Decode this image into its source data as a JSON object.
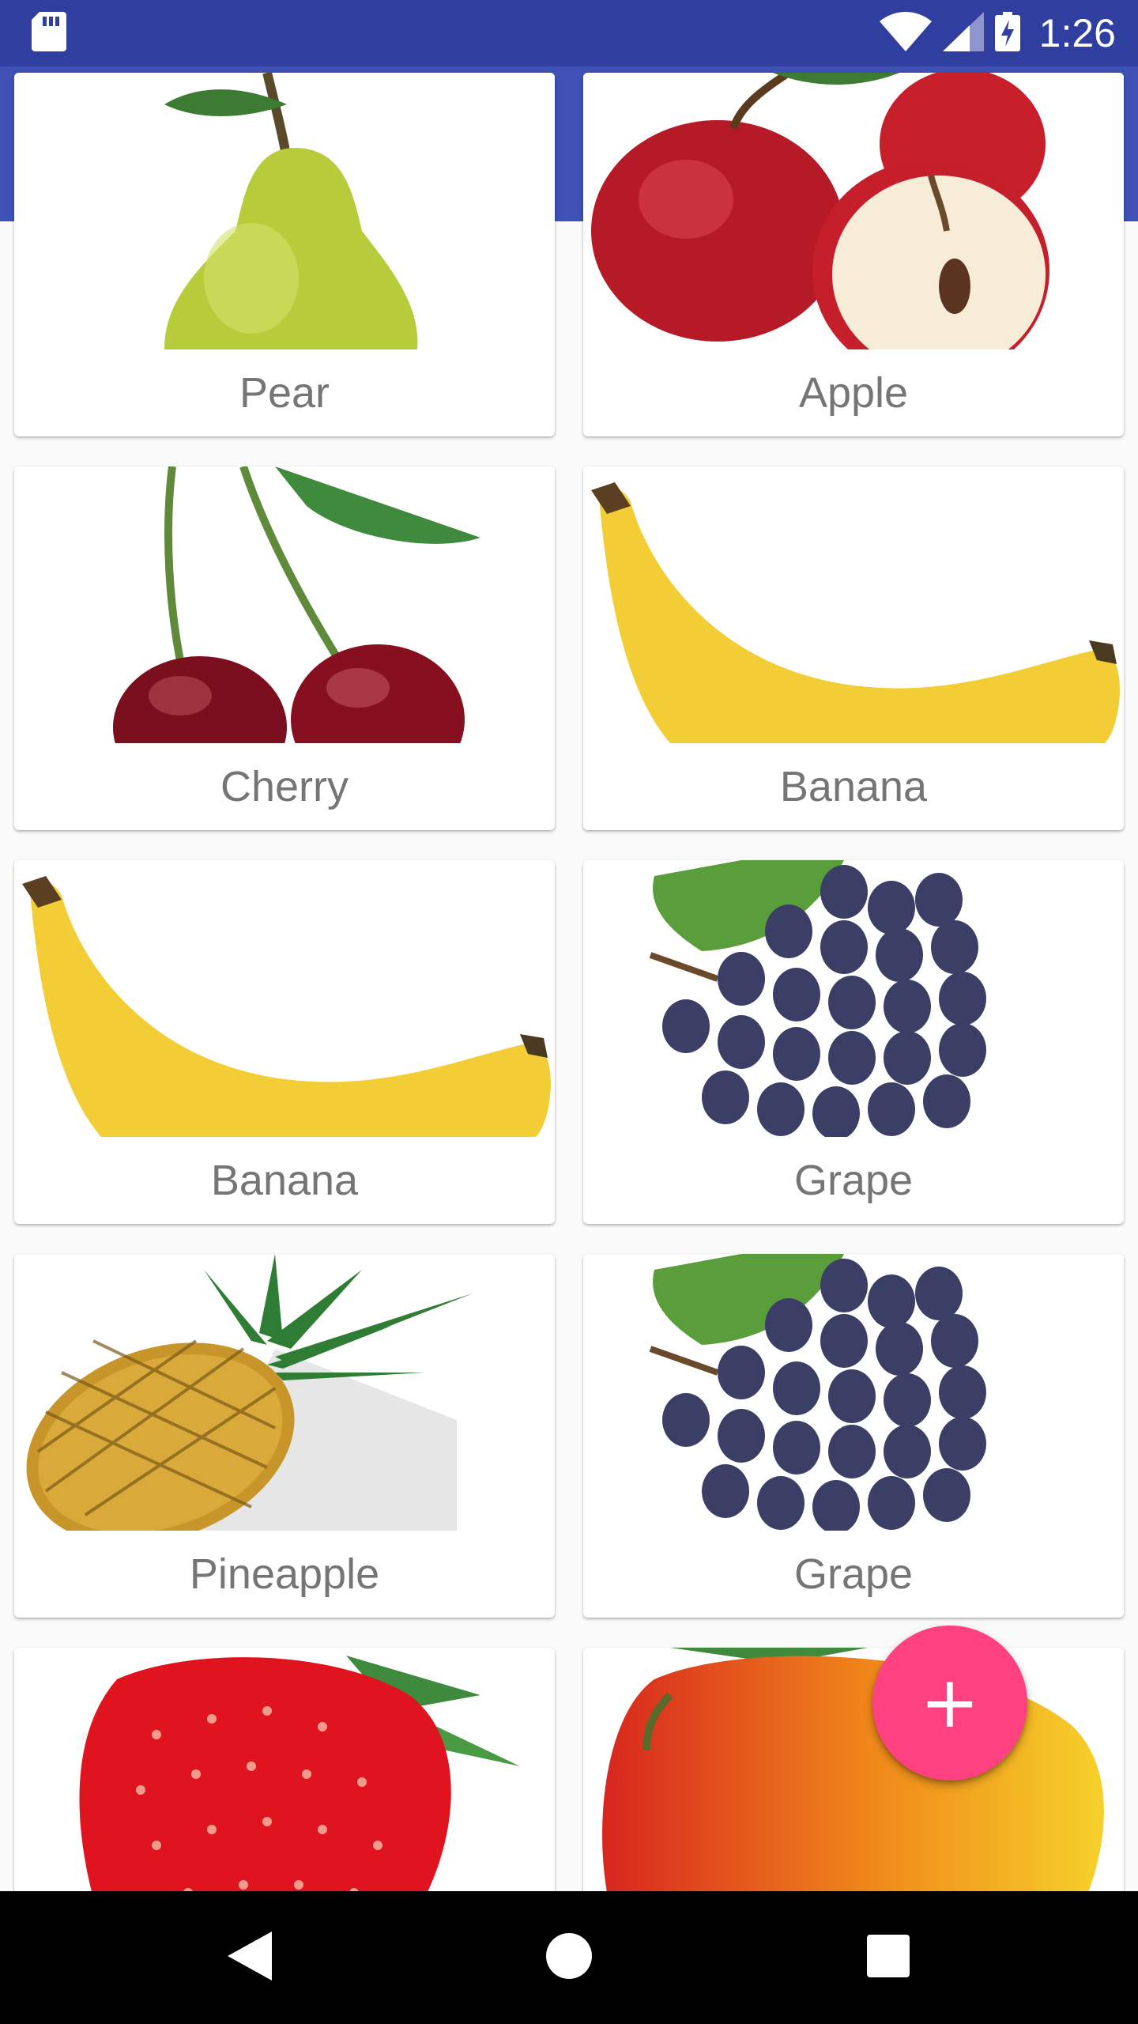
{
  "status_bar": {
    "time": "1:26",
    "icons": [
      "sd-card-icon",
      "wifi-icon",
      "cell-signal-icon",
      "battery-charging-icon"
    ],
    "color": "#303F9F"
  },
  "app_bar": {
    "color": "#3F51B5"
  },
  "fruits": [
    {
      "name": "Pear",
      "image": "pear-image"
    },
    {
      "name": "Apple",
      "image": "apple-image"
    },
    {
      "name": "Cherry",
      "image": "cherry-image"
    },
    {
      "name": "Banana",
      "image": "banana-image"
    },
    {
      "name": "Banana",
      "image": "banana-image"
    },
    {
      "name": "Grape",
      "image": "grape-image"
    },
    {
      "name": "Pineapple",
      "image": "pineapple-image"
    },
    {
      "name": "Grape",
      "image": "grape-image"
    },
    {
      "name": "",
      "image": "strawberry-image"
    },
    {
      "name": "",
      "image": "mango-image"
    }
  ],
  "fab": {
    "icon": "add-icon",
    "label": "+",
    "color": "#FF4081"
  },
  "nav_bar": {
    "icons": [
      "back-icon",
      "home-icon",
      "recents-icon"
    ]
  }
}
